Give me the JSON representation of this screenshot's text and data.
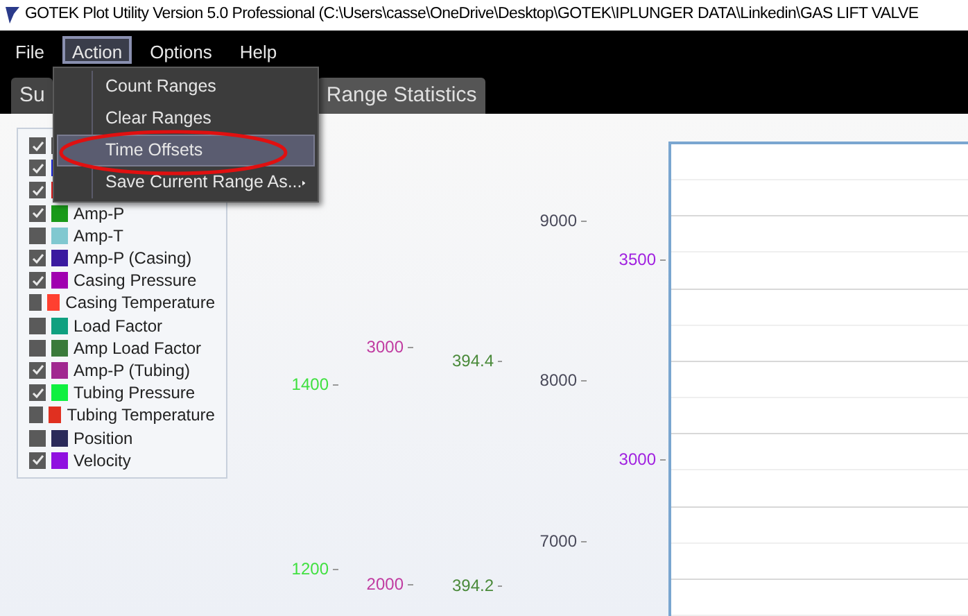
{
  "window": {
    "title": "GOTEK Plot Utility Version 5.0 Professional (C:\\Users\\casse\\OneDrive\\Desktop\\GOTEK\\IPLUNGER DATA\\Linkedin\\GAS LIFT VALVE"
  },
  "menu": [
    {
      "label": "File",
      "selected": false
    },
    {
      "label": "Action",
      "selected": true
    },
    {
      "label": "Options",
      "selected": false
    },
    {
      "label": "Help",
      "selected": false
    }
  ],
  "dropdown": [
    {
      "label": "Count Ranges",
      "highlighted": false,
      "submenu": false
    },
    {
      "label": "Clear Ranges",
      "highlighted": false,
      "submenu": false
    },
    {
      "label": "Time Offsets",
      "highlighted": true,
      "submenu": false
    },
    {
      "label": "Save Current Range As...",
      "highlighted": false,
      "submenu": true
    }
  ],
  "tabs": [
    {
      "label": "Su",
      "selected": false
    },
    {
      "label": "Range Statistics",
      "selected": true
    }
  ],
  "legend": [
    {
      "checked": true,
      "color": "#555555"
    },
    {
      "checked": true,
      "color": "#1f2be0"
    },
    {
      "checked": true,
      "color": "#e02020"
    },
    {
      "label": "Amp-P",
      "checked": true,
      "color": "#1a9a1a"
    },
    {
      "label": "Amp-T",
      "checked": false,
      "color": "#80c8d0"
    },
    {
      "label": "Amp-P (Casing)",
      "checked": true,
      "color": "#3a1aa0"
    },
    {
      "label": "Casing Pressure",
      "checked": true,
      "color": "#a000b0"
    },
    {
      "label": "Casing Temperature",
      "checked": false,
      "color": "#ff4030"
    },
    {
      "label": "Load Factor",
      "checked": false,
      "color": "#10a080"
    },
    {
      "label": "Amp Load Factor",
      "checked": false,
      "color": "#3a7a3a"
    },
    {
      "label": "Amp-P (Tubing)",
      "checked": true,
      "color": "#a02890"
    },
    {
      "label": "Tubing Pressure",
      "checked": true,
      "color": "#10f040"
    },
    {
      "label": "Tubing Temperature",
      "checked": false,
      "color": "#e03020"
    },
    {
      "label": "Position",
      "checked": false,
      "color": "#2a2a5a"
    },
    {
      "label": "Velocity",
      "checked": true,
      "color": "#9010e0"
    }
  ],
  "axes": [
    {
      "color": "#40e040",
      "ticks": [
        "1400",
        "1200"
      ]
    },
    {
      "color": "#c03aa0",
      "ticks": [
        "3000",
        "2000"
      ]
    },
    {
      "color": "#4a8a3a",
      "ticks": [
        "394.4",
        "394.2"
      ]
    },
    {
      "color": "#4a4a5a",
      "ticks": [
        "9000",
        "8000",
        "7000"
      ]
    },
    {
      "color": "#a020e0",
      "ticks": [
        "3500",
        "3000"
      ]
    }
  ]
}
